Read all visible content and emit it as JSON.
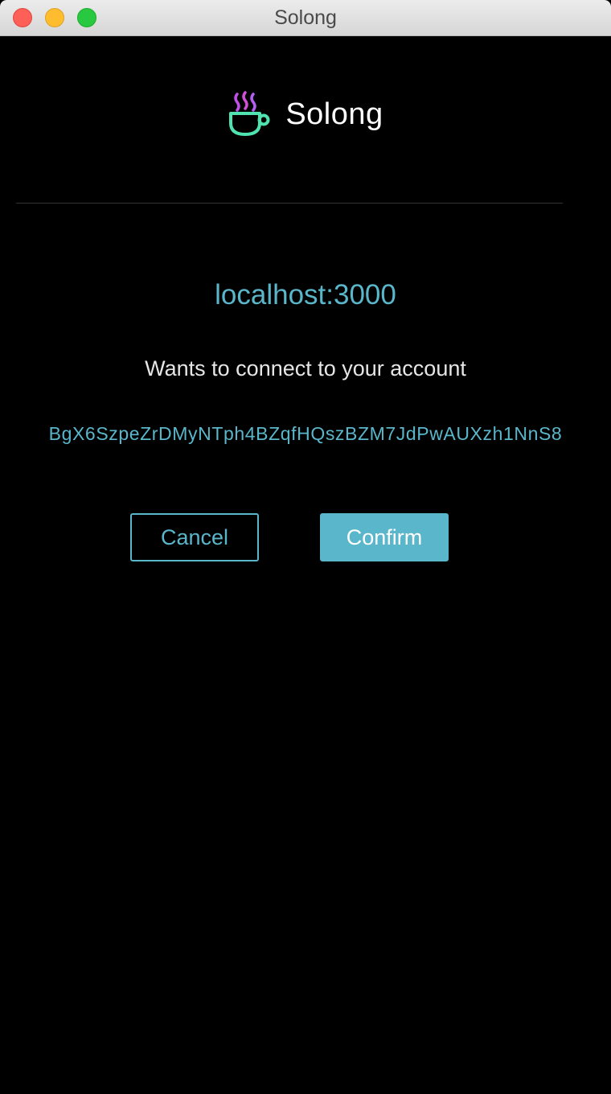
{
  "window": {
    "title": "Solong"
  },
  "brand": {
    "name": "Solong",
    "logo_icon": "coffee-cup-icon"
  },
  "request": {
    "origin": "localhost:3000",
    "message": "Wants to connect to your account",
    "address": "BgX6SzpeZrDMyNTph4BZqfHQszBZM7JdPwAUXzh1NnS8"
  },
  "actions": {
    "cancel_label": "Cancel",
    "confirm_label": "Confirm"
  },
  "colors": {
    "accent": "#5ab6ca",
    "background": "#000000",
    "logo_cup": "#4fe3b0",
    "logo_steam": "#c04fe8"
  }
}
